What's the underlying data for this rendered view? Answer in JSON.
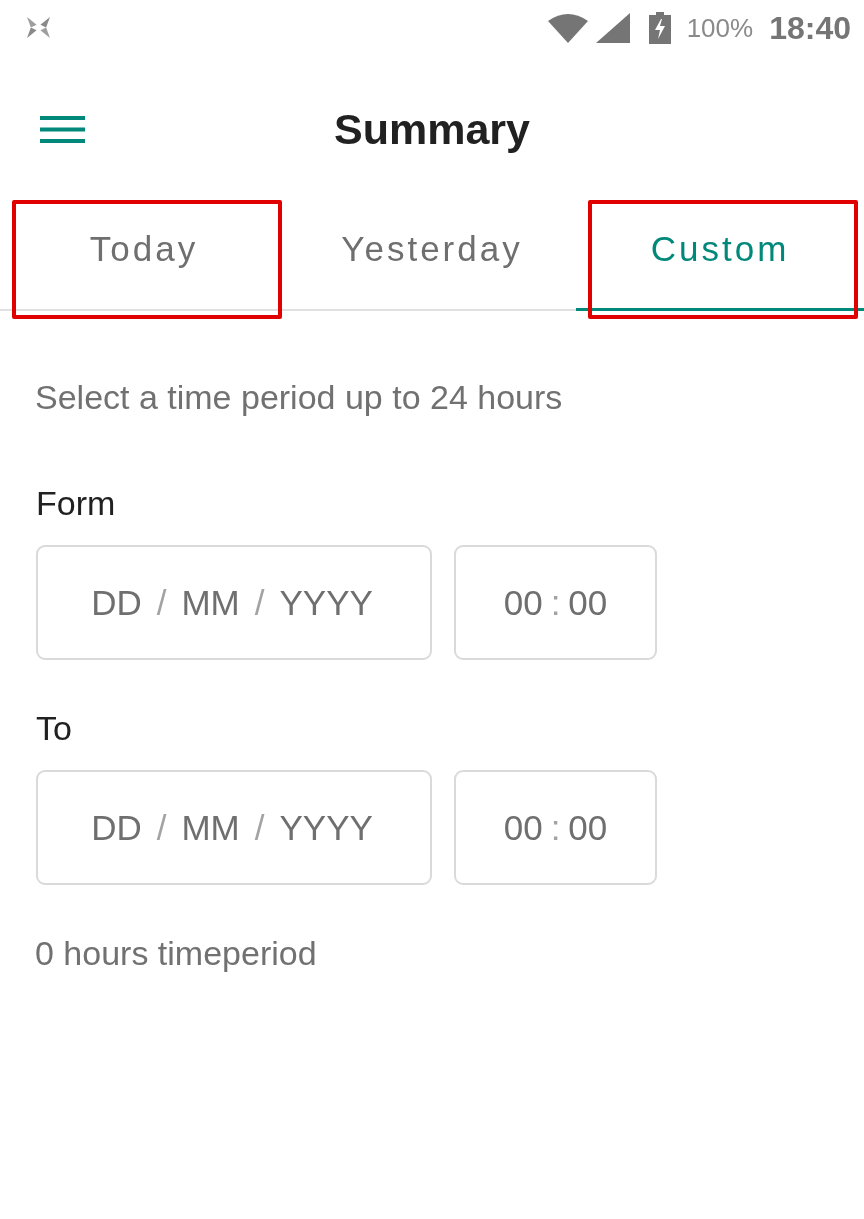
{
  "status_bar": {
    "battery": "100%",
    "time": "18:40"
  },
  "app_bar": {
    "title": "Summary"
  },
  "tabs": [
    {
      "label": "Today",
      "selected": false,
      "highlighted": true
    },
    {
      "label": "Yesterday",
      "selected": false,
      "highlighted": false
    },
    {
      "label": "Custom",
      "selected": true,
      "highlighted": true
    }
  ],
  "instructions": "Select a time period up to 24 hours",
  "ranges": [
    {
      "label": "Form",
      "date_placeholder": [
        {
          "kind": "value",
          "text": "DD"
        },
        {
          "kind": "separator",
          "text": "/"
        },
        {
          "kind": "value",
          "text": "MM"
        },
        {
          "kind": "separator",
          "text": "/"
        },
        {
          "kind": "value",
          "text": "YYYY"
        }
      ],
      "time_placeholder": [
        {
          "kind": "value",
          "text": "00"
        },
        {
          "kind": "separator",
          "text": ":"
        },
        {
          "kind": "value",
          "text": "00"
        }
      ]
    },
    {
      "label": "To",
      "date_placeholder": [
        {
          "kind": "value",
          "text": "DD"
        },
        {
          "kind": "separator",
          "text": "/"
        },
        {
          "kind": "value",
          "text": "MM"
        },
        {
          "kind": "separator",
          "text": "/"
        },
        {
          "kind": "value",
          "text": "YYYY"
        }
      ],
      "time_placeholder": [
        {
          "kind": "value",
          "text": "00"
        },
        {
          "kind": "separator",
          "text": ":"
        },
        {
          "kind": "value",
          "text": "00"
        }
      ]
    }
  ],
  "duration": "0 hours timeperiod"
}
